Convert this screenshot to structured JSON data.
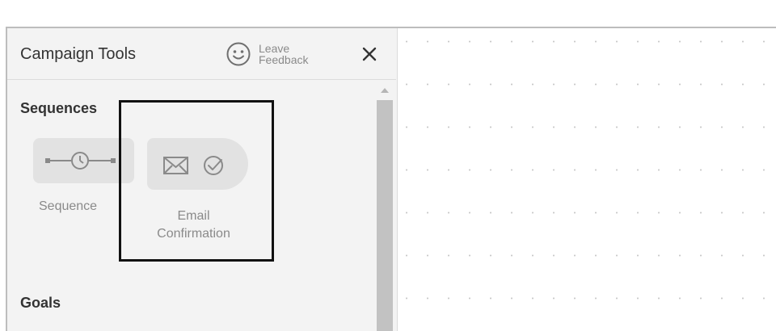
{
  "panel": {
    "title": "Campaign Tools",
    "feedback_label": "Leave Feedback",
    "feedback_icon": "smiley-icon",
    "close_icon": "close-icon"
  },
  "sections": {
    "sequences": {
      "title": "Sequences",
      "items": [
        {
          "label": "Sequence",
          "icon": "timeline-clock-icon"
        },
        {
          "label": "Email Confirmation",
          "icon": "envelope-check-icon"
        }
      ]
    },
    "goals": {
      "title": "Goals"
    }
  },
  "colors": {
    "panel_bg": "#f3f3f3",
    "pill_bg": "#e2e2e2",
    "highlight": "#111111",
    "text_muted": "#8a8a8a"
  }
}
